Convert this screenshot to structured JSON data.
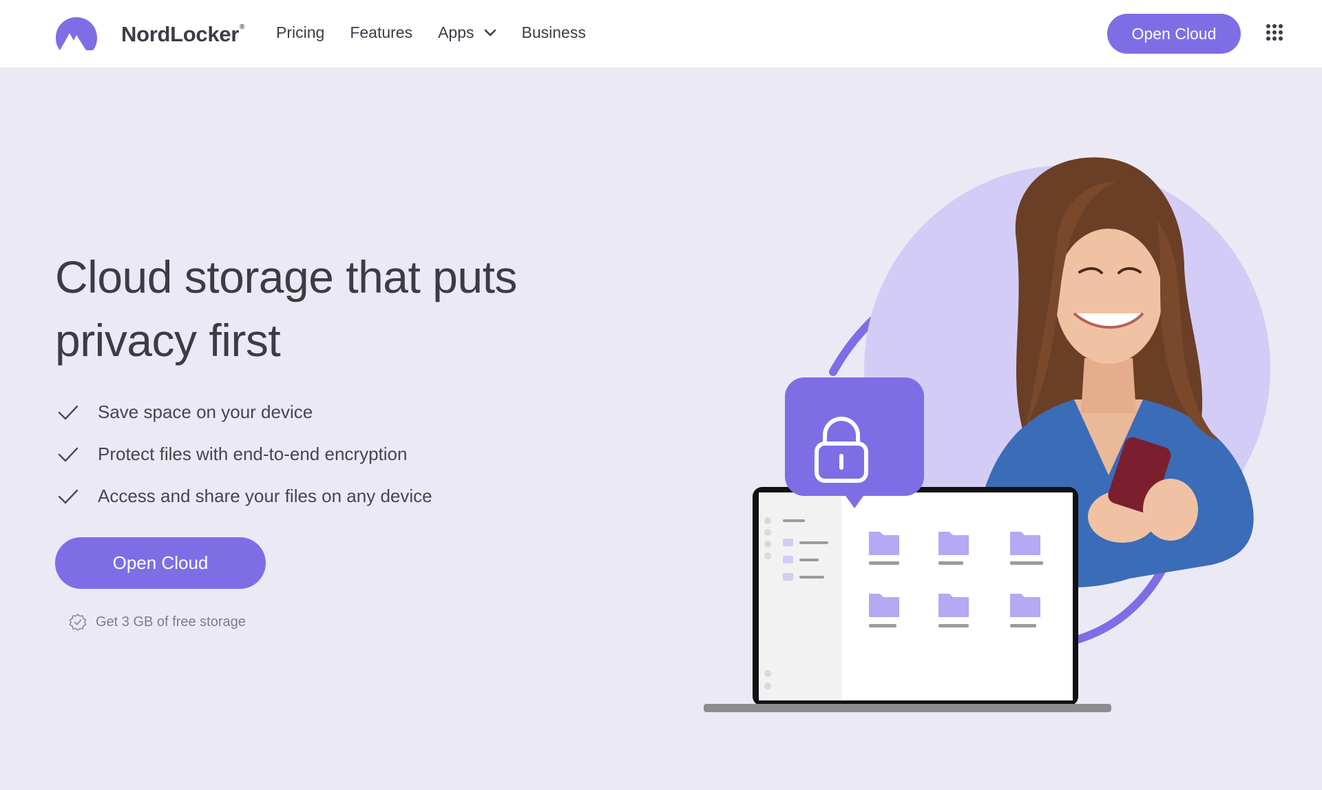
{
  "brand": {
    "name": "NordLocker",
    "mark": "®",
    "accent": "#7e6ee6"
  },
  "nav": {
    "items": [
      {
        "label": "Pricing"
      },
      {
        "label": "Features"
      },
      {
        "label": "Apps"
      },
      {
        "label": "Business"
      }
    ],
    "cta_label": "Open Cloud",
    "apps_menu_icon": "grid-icon"
  },
  "hero": {
    "title": "Cloud storage that puts privacy first",
    "features": [
      "Save space on your device",
      "Protect files with end-to-end encryption",
      "Access and share your files on any device"
    ],
    "cta_label": "Open Cloud",
    "note": "Get 3 GB of free storage"
  },
  "colors": {
    "background": "#ebe9f4",
    "header": "#ffffff",
    "accent": "#7e6ee6",
    "text": "#3b3c44"
  }
}
